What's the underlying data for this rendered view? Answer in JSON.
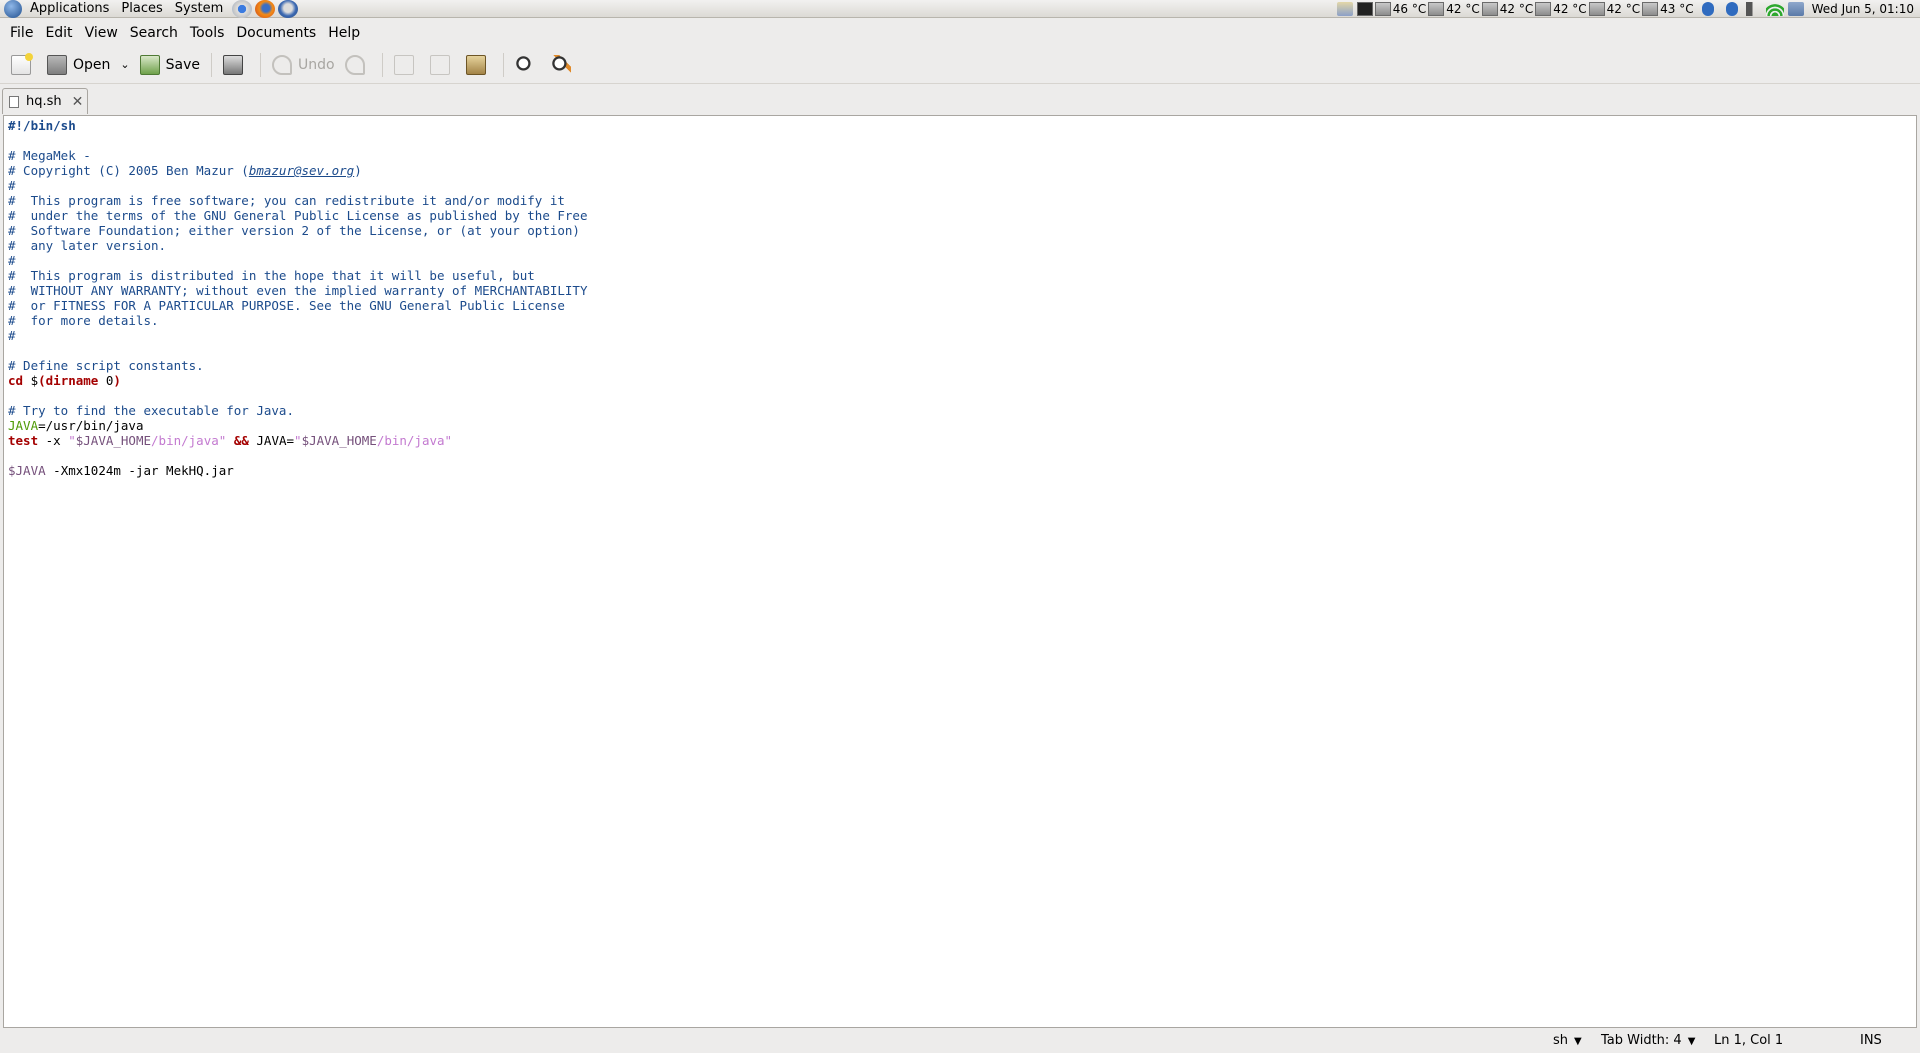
{
  "panel": {
    "menus": [
      "Applications",
      "Places",
      "System"
    ],
    "temps": [
      "46 °C",
      "42 °C",
      "42 °C",
      "42 °C",
      "42 °C",
      "43 °C"
    ],
    "clock": "Wed Jun  5, 01:10"
  },
  "menubar": [
    "File",
    "Edit",
    "View",
    "Search",
    "Tools",
    "Documents",
    "Help"
  ],
  "toolbar": {
    "open_label": "Open",
    "save_label": "Save",
    "undo_label": "Undo"
  },
  "tab": {
    "filename": "hq.sh",
    "close_glyph": "✕"
  },
  "editor": {
    "lines": [
      "#!/bin/sh",
      "",
      "# MegaMek -",
      "# Copyright (C) 2005 Ben Mazur (bmazur@sev.org)",
      "#",
      "#  This program is free software; you can redistribute it and/or modify it",
      "#  under the terms of the GNU General Public License as published by the Free",
      "#  Software Foundation; either version 2 of the License, or (at your option)",
      "#  any later version.",
      "#",
      "#  This program is distributed in the hope that it will be useful, but",
      "#  WITHOUT ANY WARRANTY; without even the implied warranty of MERCHANTABILITY",
      "#  or FITNESS FOR A PARTICULAR PURPOSE. See the GNU General Public License",
      "#  for more details.",
      "#",
      "",
      "# Define script constants.",
      "cd $(dirname 0)",
      "",
      "# Try to find the executable for Java.",
      "JAVA=/usr/bin/java",
      "test -x \"$JAVA_HOME/bin/java\" && JAVA=\"$JAVA_HOME/bin/java\"",
      "",
      "$JAVA -Xmx1024m -jar MekHQ.jar"
    ]
  },
  "statusbar": {
    "language": "sh",
    "tab_width": "Tab Width: 4",
    "position": "Ln 1, Col 1",
    "mode": "INS"
  }
}
